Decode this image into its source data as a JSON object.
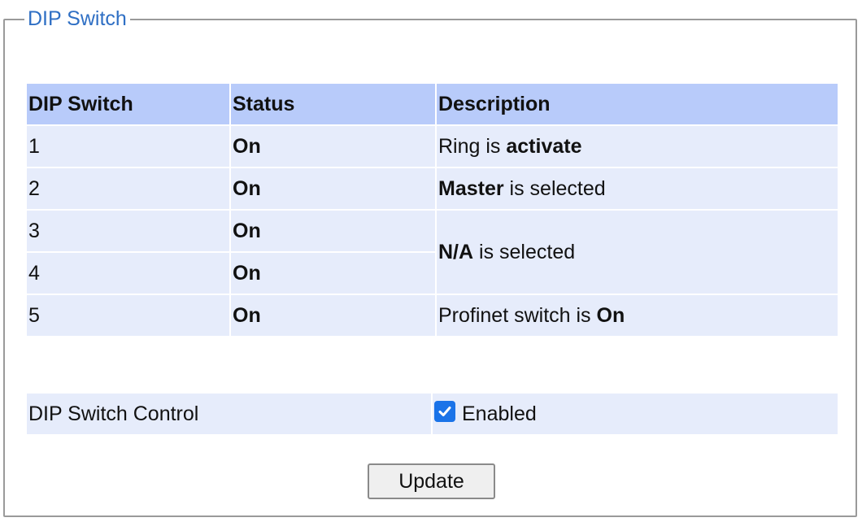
{
  "panel": {
    "legend": "DIP Switch"
  },
  "table": {
    "headers": [
      "DIP Switch",
      "Status",
      "Description"
    ],
    "rows": [
      {
        "num": "1",
        "status": "On",
        "desc_pre": "Ring is ",
        "desc_bold": "activate",
        "desc_post": ""
      },
      {
        "num": "2",
        "status": "On",
        "desc_pre": "",
        "desc_bold": "Master",
        "desc_post": " is selected"
      },
      {
        "num": "3",
        "status": "On",
        "desc_pre": "",
        "desc_bold": "N/A",
        "desc_post": " is selected"
      },
      {
        "num": "4",
        "status": "On"
      },
      {
        "num": "5",
        "status": "On",
        "desc_pre": "Profinet switch is ",
        "desc_bold": "On",
        "desc_post": ""
      }
    ]
  },
  "control": {
    "label": "DIP Switch Control",
    "checkbox_label": "Enabled",
    "checked": true
  },
  "buttons": {
    "update": "Update"
  },
  "colors": {
    "legend": "#2f6fc4",
    "header_bg": "#b8cbfa",
    "row_bg": "#e6ecfb",
    "checkbox": "#1a73e8"
  }
}
